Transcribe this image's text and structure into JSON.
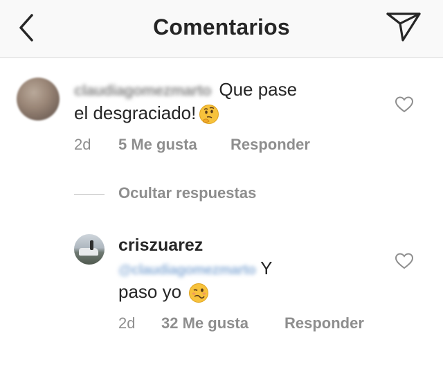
{
  "header": {
    "title": "Comentarios",
    "back_icon": "chevron-left-icon",
    "send_icon": "paper-plane-icon"
  },
  "comments": [
    {
      "username": "claudiagomezmarto",
      "text_line1": "Que pase",
      "text_line2": "el desgraciado!",
      "emoji": "thinking-face-icon",
      "time": "2d",
      "likes": "5 Me gusta",
      "reply_label": "Responder",
      "hide_replies": "Ocultar respuestas",
      "replies": [
        {
          "username": "criszuarez",
          "mention": "@claudiagomezmarto",
          "text_line1": "Y",
          "text_line2": "paso yo",
          "emoji": "woozy-face-icon",
          "time": "2d",
          "likes": "32 Me gusta",
          "reply_label": "Responder"
        }
      ]
    }
  ],
  "colors": {
    "text": "#262626",
    "muted": "#8e8e8e",
    "header_bg": "#f9f9f9",
    "mention": "#8fb1d9"
  }
}
